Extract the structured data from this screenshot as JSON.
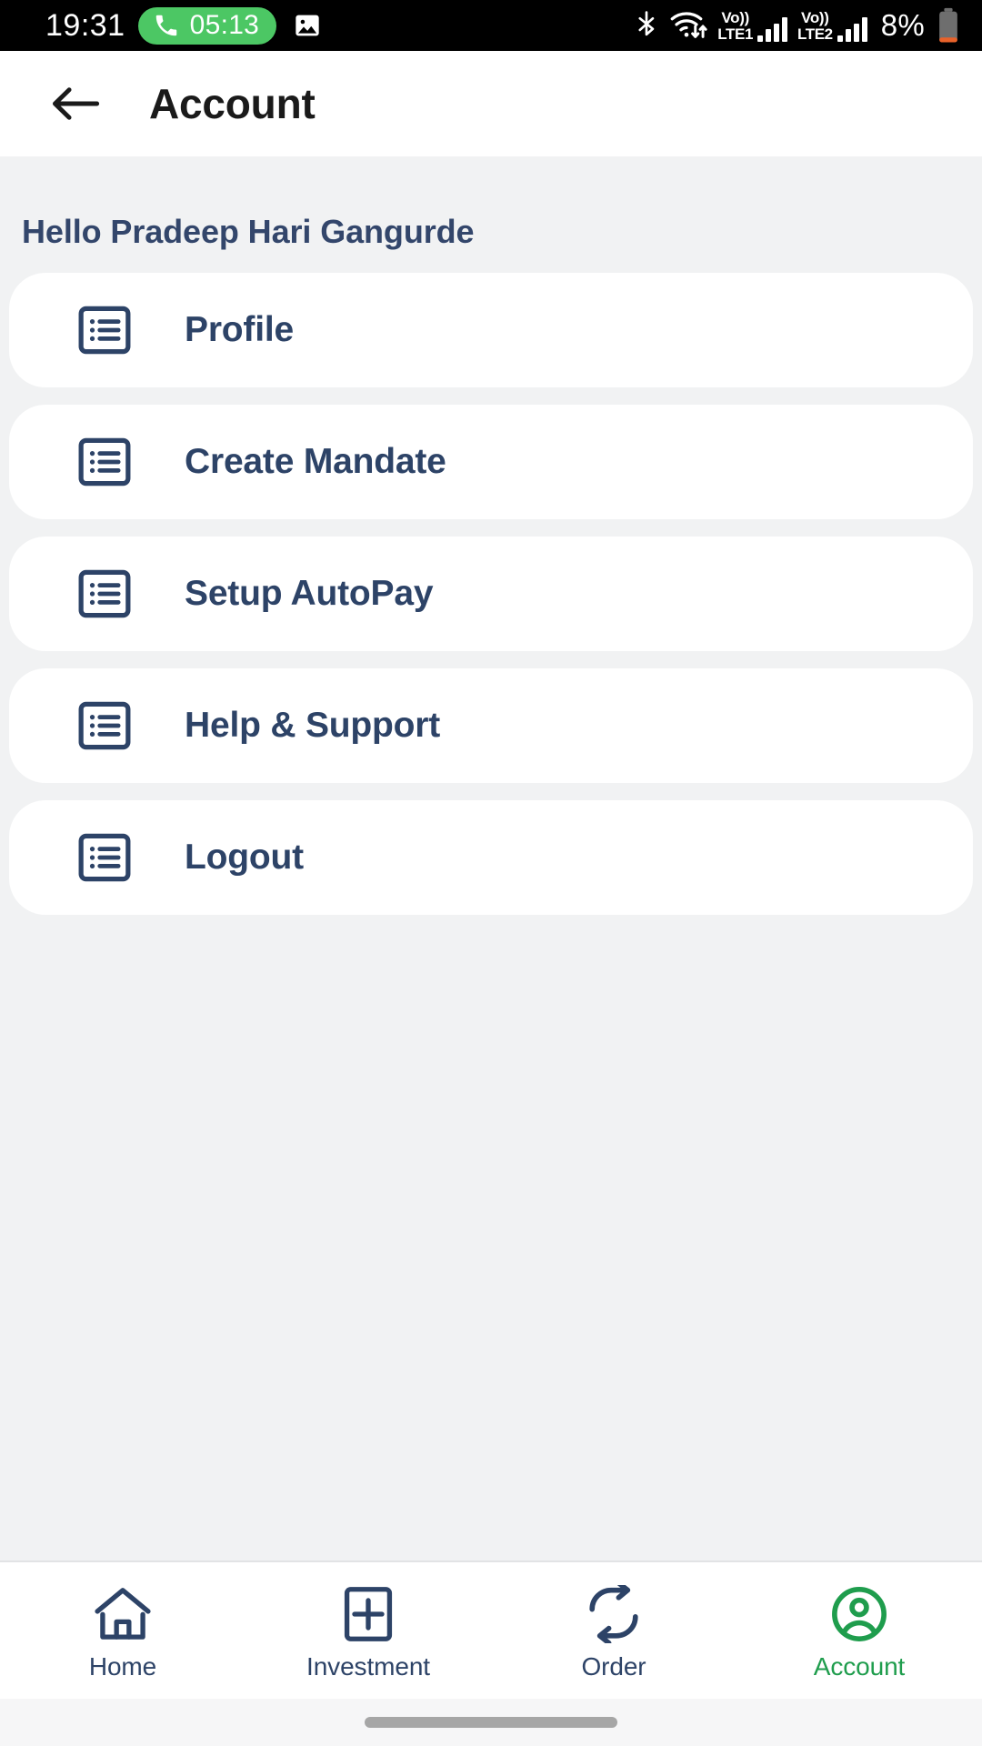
{
  "status_bar": {
    "clock": "19:31",
    "call_timer": "05:13",
    "call_icon": "phone-icon",
    "gallery_icon": "gallery-icon",
    "bluetooth_icon": "bluetooth-icon",
    "wifi_icon": "wifi-data-icon",
    "sim1": {
      "volte_top": "Vo))",
      "volte_bottom": "LTE1",
      "bars": 4
    },
    "sim2": {
      "volte_top": "Vo))",
      "volte_bottom": "LTE2",
      "bars": 4
    },
    "battery_percent": "8%",
    "battery_icon": "battery-low-icon",
    "colors": {
      "call_pill": "#4CC764",
      "battery_low": "#e8622a",
      "bg": "#000000"
    }
  },
  "header": {
    "back_icon": "arrow-left-icon",
    "title": "Account"
  },
  "main": {
    "greeting": "Hello Pradeep Hari Gangurde",
    "menu_items": [
      {
        "label": "Profile",
        "icon": "list-icon"
      },
      {
        "label": "Create Mandate",
        "icon": "list-icon"
      },
      {
        "label": "Setup AutoPay",
        "icon": "list-icon"
      },
      {
        "label": "Help & Support",
        "icon": "list-icon"
      },
      {
        "label": "Logout",
        "icon": "list-icon"
      }
    ]
  },
  "bottom_nav": {
    "items": [
      {
        "label": "Home",
        "icon": "home-icon",
        "active": false
      },
      {
        "label": "Investment",
        "icon": "plus-box-icon",
        "active": false
      },
      {
        "label": "Order",
        "icon": "swap-arrows-icon",
        "active": false
      },
      {
        "label": "Account",
        "icon": "user-circle-icon",
        "active": true
      }
    ],
    "active_color": "#1f9d4d",
    "inactive_color": "#2d4367"
  },
  "theme": {
    "page_bg": "#f1f2f3",
    "card_bg": "#ffffff",
    "navy": "#2d4367",
    "greeting_color": "#33466b"
  }
}
